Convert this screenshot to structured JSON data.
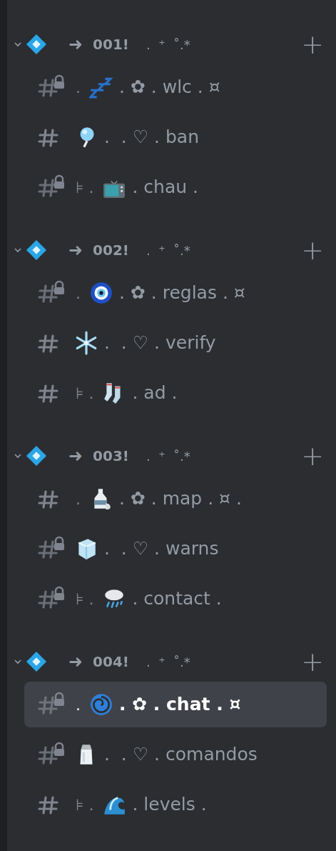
{
  "categories": [
    {
      "expanded": true,
      "arrow": "➜",
      "name": "001!",
      "trail": ".  ⁺  ˚.*",
      "add": "+",
      "channels": [
        {
          "locked": true,
          "selected": false,
          "lead": ".",
          "kind": "zzz",
          "rest": ". ✿ . wlc . ¤"
        },
        {
          "locked": false,
          "selected": false,
          "kind": "balloon",
          "rest": ".  . ♡ . ban"
        },
        {
          "locked": true,
          "selected": false,
          "lead": "⊧ .",
          "kind": "tv",
          "rest": ". chau ."
        }
      ]
    },
    {
      "expanded": true,
      "arrow": "➜",
      "name": "002!",
      "trail": ".  ⁺  ˚.*",
      "add": "+",
      "channels": [
        {
          "locked": true,
          "selected": false,
          "lead": ".",
          "kind": "eye",
          "rest": ". ✿ . reglas . ¤"
        },
        {
          "locked": false,
          "selected": false,
          "kind": "snowflake",
          "rest": ".  . ♡ . verify"
        },
        {
          "locked": false,
          "selected": false,
          "lead": "⊧ .",
          "kind": "socks",
          "rest": ". ad ."
        }
      ]
    },
    {
      "expanded": true,
      "arrow": "➜",
      "name": "003!",
      "trail": ".  ⁺  ˚.*",
      "add": "+",
      "channels": [
        {
          "locked": false,
          "selected": false,
          "lead": ".",
          "kind": "bottle",
          "rest": ". ✿ . map . ¤ ."
        },
        {
          "locked": true,
          "selected": false,
          "kind": "ice",
          "rest": ".  . ♡ . warns"
        },
        {
          "locked": true,
          "selected": false,
          "lead": "⊧ .",
          "kind": "rain",
          "rest": ". contact ."
        }
      ]
    },
    {
      "expanded": true,
      "arrow": "➜",
      "name": "004!",
      "trail": ".  ⁺  ˚.*",
      "add": "+",
      "channels": [
        {
          "locked": true,
          "selected": true,
          "lead": ".",
          "kind": "cyclone",
          "rest": ". ✿ . chat . ¤"
        },
        {
          "locked": true,
          "selected": false,
          "kind": "salt",
          "rest": ".  . ♡ . comandos"
        },
        {
          "locked": false,
          "selected": false,
          "lead": "⊧ .",
          "kind": "wave",
          "rest": ". levels ."
        }
      ]
    }
  ]
}
